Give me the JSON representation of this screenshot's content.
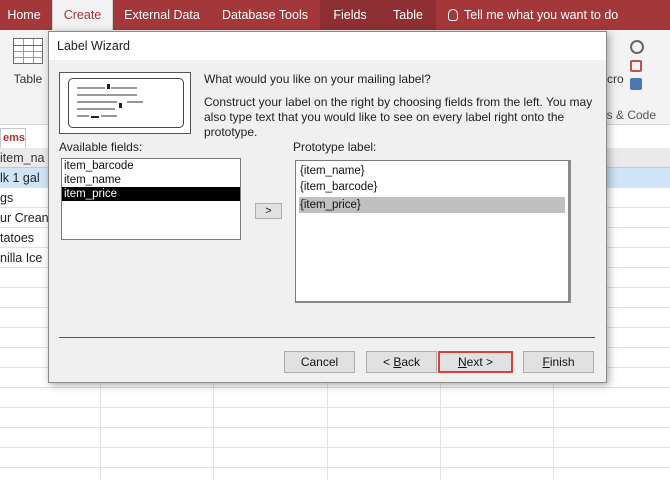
{
  "ribbon": {
    "tabs": [
      {
        "label": "Home"
      },
      {
        "label": "Create"
      },
      {
        "label": "External Data"
      },
      {
        "label": "Database Tools"
      },
      {
        "label": "Fields"
      },
      {
        "label": "Table"
      }
    ],
    "tell_me": "Tell me what you want to do",
    "table_button": "Table",
    "macro_label": "cro",
    "macros_group_label": "os & Code"
  },
  "background": {
    "nav_tab_label": "ems",
    "column_header": "item_na",
    "rows": [
      "lk 1 gal",
      "gs",
      "ur Crean",
      "tatoes",
      "nilla Ice"
    ]
  },
  "dialog": {
    "title": "Label Wizard",
    "prompt": "What would you like on your mailing label?",
    "description": "Construct your label on the right by choosing fields from the left. You may also type text that you would like to see on every label right onto the prototype.",
    "available_label": "Available fields:",
    "available_fields": [
      "item_barcode",
      "item_name",
      "item_price"
    ],
    "selected_field": "item_price",
    "add_button": ">",
    "prototype_label": "Prototype label:",
    "prototype_lines": [
      "{item_name}",
      "{item_barcode}",
      "{item_price}"
    ],
    "buttons": {
      "cancel": "Cancel",
      "back_prefix": "< ",
      "back_key": "B",
      "back_rest": "ack",
      "next_key": "N",
      "next_rest": "ext >",
      "finish_key": "F",
      "finish_rest": "inish"
    }
  }
}
